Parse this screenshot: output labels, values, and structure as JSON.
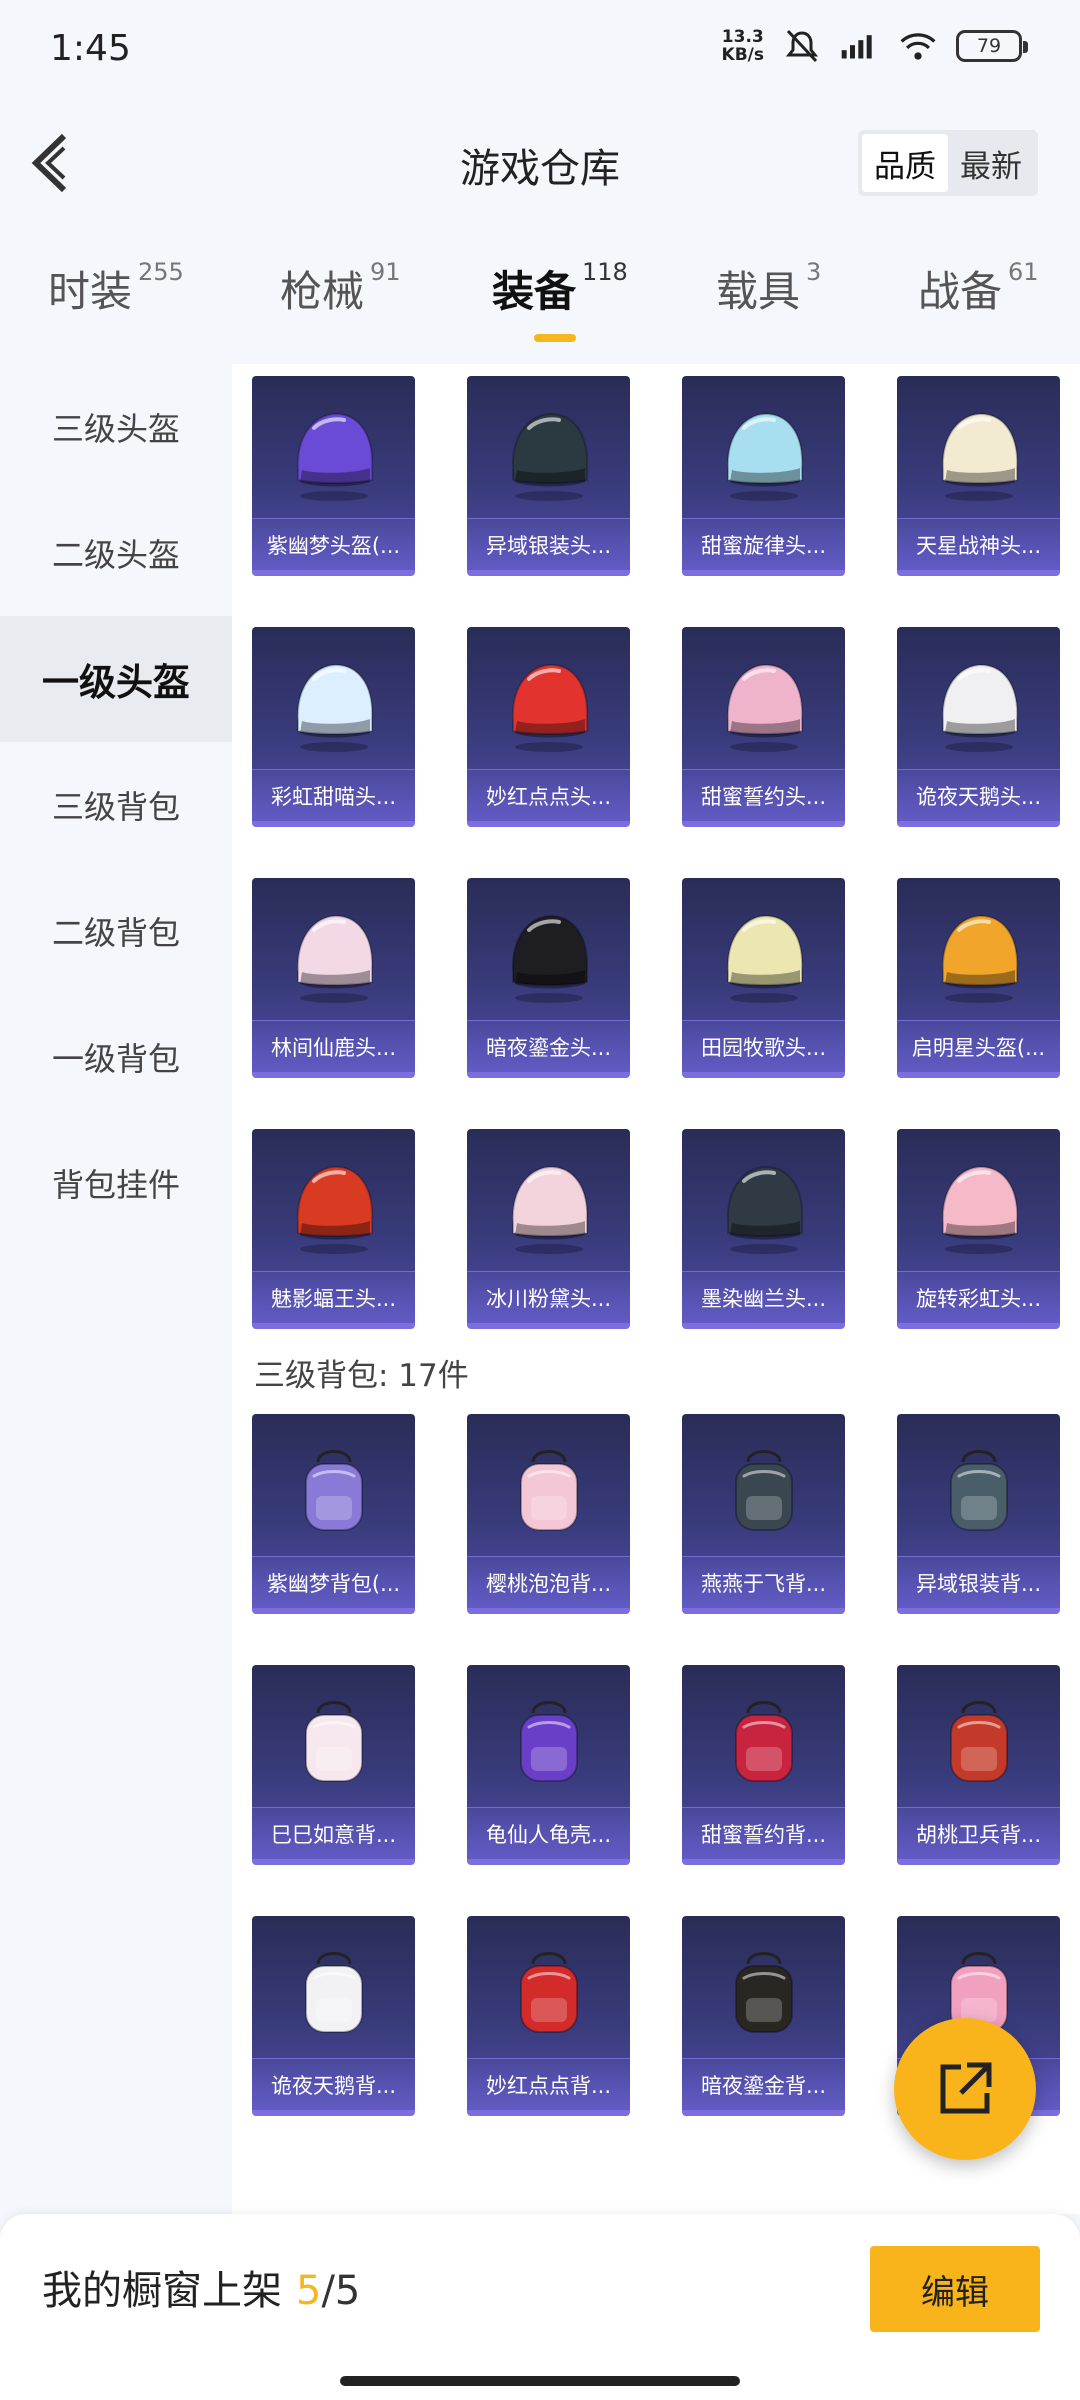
{
  "status": {
    "time": "1:45",
    "speed_top": "13.3",
    "speed_bottom": "KB/s",
    "battery": "79"
  },
  "header": {
    "title": "游戏仓库",
    "sort_options": [
      "品质",
      "最新"
    ],
    "active_sort": 0
  },
  "tabs": [
    {
      "label": "时装",
      "count": "255"
    },
    {
      "label": "枪械",
      "count": "91"
    },
    {
      "label": "装备",
      "count": "118"
    },
    {
      "label": "载具",
      "count": "3"
    },
    {
      "label": "战备",
      "count": "61"
    }
  ],
  "active_tab": 2,
  "sidebar": {
    "items": [
      "三级头盔",
      "二级头盔",
      "一级头盔",
      "三级背包",
      "二级背包",
      "一级背包",
      "背包挂件"
    ],
    "active": 2
  },
  "helmets": [
    {
      "name": "紫幽梦头盔(...",
      "color": "#6a4bd6"
    },
    {
      "name": "异域银装头...",
      "color": "#2a3a40"
    },
    {
      "name": "甜蜜旋律头...",
      "color": "#a8dff0"
    },
    {
      "name": "天星战神头...",
      "color": "#f3ead2"
    },
    {
      "name": "彩虹甜喵头...",
      "color": "#dcefff"
    },
    {
      "name": "妙红点点头...",
      "color": "#e2332e"
    },
    {
      "name": "甜蜜誓约头...",
      "color": "#efb3cc"
    },
    {
      "name": "诡夜天鹅头...",
      "color": "#f0f0f2"
    },
    {
      "name": "林间仙鹿头...",
      "color": "#f3d9e6"
    },
    {
      "name": "暗夜鎏金头...",
      "color": "#1e1e22"
    },
    {
      "name": "田园牧歌头...",
      "color": "#ece6b0"
    },
    {
      "name": "启明星头盔(...",
      "color": "#f1a52b"
    },
    {
      "name": "魅影蝠王头...",
      "color": "#d83a22"
    },
    {
      "name": "冰川粉黛头...",
      "color": "#f3d3dc"
    },
    {
      "name": "墨染幽兰头...",
      "color": "#2f3a44"
    },
    {
      "name": "旋转彩虹头...",
      "color": "#f6b9c8"
    }
  ],
  "backpack_section": {
    "title": "三级背包: 17件"
  },
  "backpacks": [
    {
      "name": "紫幽梦背包(...",
      "color": "#8a7ad8"
    },
    {
      "name": "樱桃泡泡背...",
      "color": "#f3c7d6"
    },
    {
      "name": "燕燕于飞背...",
      "color": "#3a4750"
    },
    {
      "name": "异域银装背...",
      "color": "#4a5e6a"
    },
    {
      "name": "巳巳如意背...",
      "color": "#f6e8ee"
    },
    {
      "name": "龟仙人龟壳...",
      "color": "#6a3fc8"
    },
    {
      "name": "甜蜜誓约背...",
      "color": "#c8233f"
    },
    {
      "name": "胡桃卫兵背...",
      "color": "#c43a2a"
    },
    {
      "name": "诡夜天鹅背...",
      "color": "#f2f2f5"
    },
    {
      "name": "妙红点点背...",
      "color": "#d32a2a"
    },
    {
      "name": "暗夜鎏金背...",
      "color": "#2a2622"
    },
    {
      "name": "",
      "color": "#f2a0c0"
    }
  ],
  "bottom": {
    "label": "我的橱窗上架",
    "current": "5",
    "total": "/5",
    "edit": "编辑"
  }
}
